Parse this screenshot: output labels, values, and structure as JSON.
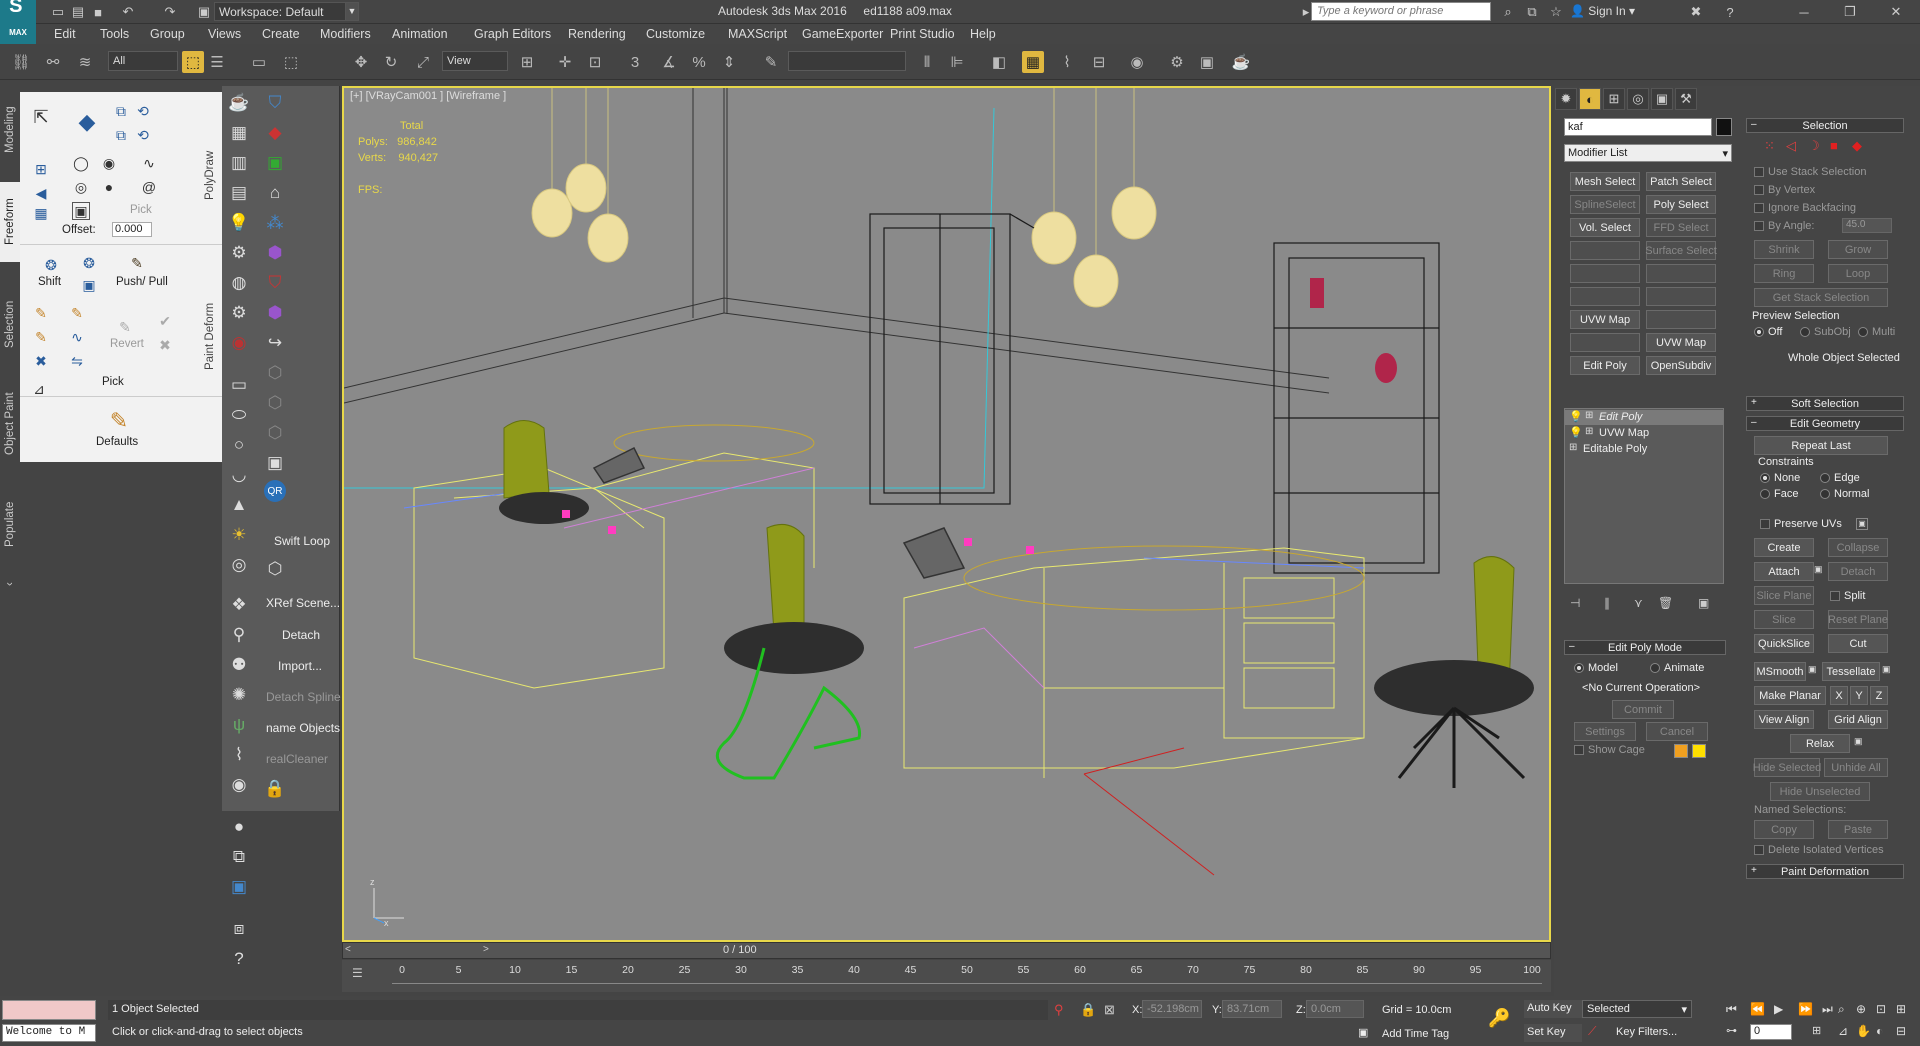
{
  "titlebar": {
    "workspace": "Workspace: Default",
    "app_title": "Autodesk 3ds Max 2016",
    "file_name": "ed1188 a09.max",
    "search_placeholder": "Type a keyword or phrase",
    "sign_in": "Sign In"
  },
  "logo": {
    "text": "MAX"
  },
  "menubar": [
    "Edit",
    "Tools",
    "Group",
    "Views",
    "Create",
    "Modifiers",
    "Animation",
    "Graph Editors",
    "Rendering",
    "Customize",
    "MAXScript",
    "GameExporter",
    "Print Studio",
    "Help"
  ],
  "toolbar": {
    "selection_filter": "All",
    "ref_coord": "View",
    "named_selection": ""
  },
  "left_tabs": [
    "Modeling",
    "Freeform",
    "Selection",
    "Object Paint",
    "Populate"
  ],
  "freeform": {
    "pick_label": "Pick",
    "offset_label": "Offset:",
    "offset_value": "0.000",
    "shift_label": "Shift",
    "push_pull_label": "Push/ Pull",
    "revert_label": "Revert",
    "pick2_label": "Pick",
    "defaults_label": "Defaults",
    "polydraw_label": "PolyDraw",
    "paint_deform_label": "Paint Deform"
  },
  "left_stack": {
    "swift_loop": "Swift Loop",
    "xref": "XRef Scene...",
    "detach": "Detach",
    "import": "Import...",
    "detach_spline": "Detach Spline",
    "rename": "name Objects",
    "cleaner": "realCleaner"
  },
  "viewport": {
    "label": "[+] [VRayCam001 ] [Wireframe ]",
    "stats_total": "Total",
    "polys_label": "Polys:",
    "polys_value": "986,842",
    "verts_label": "Verts:",
    "verts_value": "940,427",
    "fps_label": "FPS:"
  },
  "timeline": {
    "frame_counter": "0 / 100",
    "ticks": [
      "0",
      "5",
      "10",
      "15",
      "20",
      "25",
      "30",
      "35",
      "40",
      "45",
      "50",
      "55",
      "60",
      "65",
      "70",
      "75",
      "80",
      "85",
      "90",
      "95",
      "100"
    ]
  },
  "command_panel": {
    "object_name": "kaf",
    "modifier_list": "Modifier List",
    "mod_buttons": [
      {
        "label": "Mesh Select",
        "enabled": true
      },
      {
        "label": "Patch Select",
        "enabled": true
      },
      {
        "label": "SplineSelect",
        "enabled": false
      },
      {
        "label": "Poly Select",
        "enabled": true
      },
      {
        "label": "Vol. Select",
        "enabled": true
      },
      {
        "label": "FFD Select",
        "enabled": false
      },
      {
        "label": "",
        "enabled": false
      },
      {
        "label": "Surface Select",
        "enabled": false
      },
      {
        "label": "",
        "enabled": false
      },
      {
        "label": "",
        "enabled": false
      },
      {
        "label": "",
        "enabled": false
      },
      {
        "label": "",
        "enabled": false
      },
      {
        "label": "UVW Map",
        "enabled": true
      },
      {
        "label": "",
        "enabled": false
      },
      {
        "label": "",
        "enabled": false
      },
      {
        "label": "UVW Map",
        "enabled": true
      },
      {
        "label": "Edit Poly",
        "enabled": true
      },
      {
        "label": "OpenSubdiv",
        "enabled": true
      }
    ],
    "stack": [
      "Edit Poly",
      "UVW Map",
      "Editable Poly"
    ],
    "edit_poly_mode": {
      "title": "Edit Poly Mode",
      "model": "Model",
      "animate": "Animate",
      "current_op": "<No Current Operation>",
      "commit": "Commit",
      "settings": "Settings",
      "cancel": "Cancel",
      "show_cage": "Show Cage"
    }
  },
  "selection_rollout": {
    "title": "Selection",
    "use_stack": "Use Stack Selection",
    "by_vertex": "By Vertex",
    "ignore_backfacing": "Ignore Backfacing",
    "by_angle": "By Angle:",
    "by_angle_value": "45.0",
    "shrink": "Shrink",
    "grow": "Grow",
    "ring": "Ring",
    "loop": "Loop",
    "get_stack": "Get Stack Selection",
    "preview_selection": "Preview Selection",
    "off": "Off",
    "subobj": "SubObj",
    "multi": "Multi",
    "whole_object": "Whole Object Selected",
    "soft_selection": "Soft Selection",
    "edit_geometry": "Edit Geometry",
    "repeat_last": "Repeat Last",
    "constraints": "Constraints",
    "none": "None",
    "edge": "Edge",
    "face": "Face",
    "normal": "Normal",
    "preserve_uvs": "Preserve UVs",
    "create": "Create",
    "collapse": "Collapse",
    "attach": "Attach",
    "detach": "Detach",
    "slice_plane": "Slice Plane",
    "split": "Split",
    "slice": "Slice",
    "reset_plane": "Reset Plane",
    "quickslice": "QuickSlice",
    "cut": "Cut",
    "msmooth": "MSmooth",
    "tessellate": "Tessellate",
    "make_planar": "Make Planar",
    "x": "X",
    "y": "Y",
    "z": "Z",
    "view_align": "View Align",
    "grid_align": "Grid Align",
    "relax": "Relax",
    "hide_selected": "Hide Selected",
    "unhide_all": "Unhide All",
    "hide_unselected": "Hide Unselected",
    "named_selections": "Named Selections:",
    "copy": "Copy",
    "paste": "Paste",
    "delete_isolated": "Delete Isolated Vertices",
    "paint_deformation": "Paint Deformation"
  },
  "statusbar": {
    "listener": "Welcome to M",
    "selected": "1 Object Selected",
    "prompt": "Click or click-and-drag to select objects",
    "x_label": "X:",
    "x_value": "-52.198cm",
    "y_label": "Y:",
    "y_value": "83.71cm",
    "z_label": "Z:",
    "z_value": "0.0cm",
    "grid": "Grid = 10.0cm",
    "add_time_tag": "Add Time Tag",
    "auto_key": "Auto Key",
    "set_key": "Set Key",
    "key_mode": "Selected",
    "key_filters": "Key Filters...",
    "frame": "0"
  },
  "colors": {
    "accent": "#e0b840",
    "viewport_border": "#e8d84a",
    "viewport_bg": "#8a8a8a",
    "stats": "#e8d84a"
  }
}
